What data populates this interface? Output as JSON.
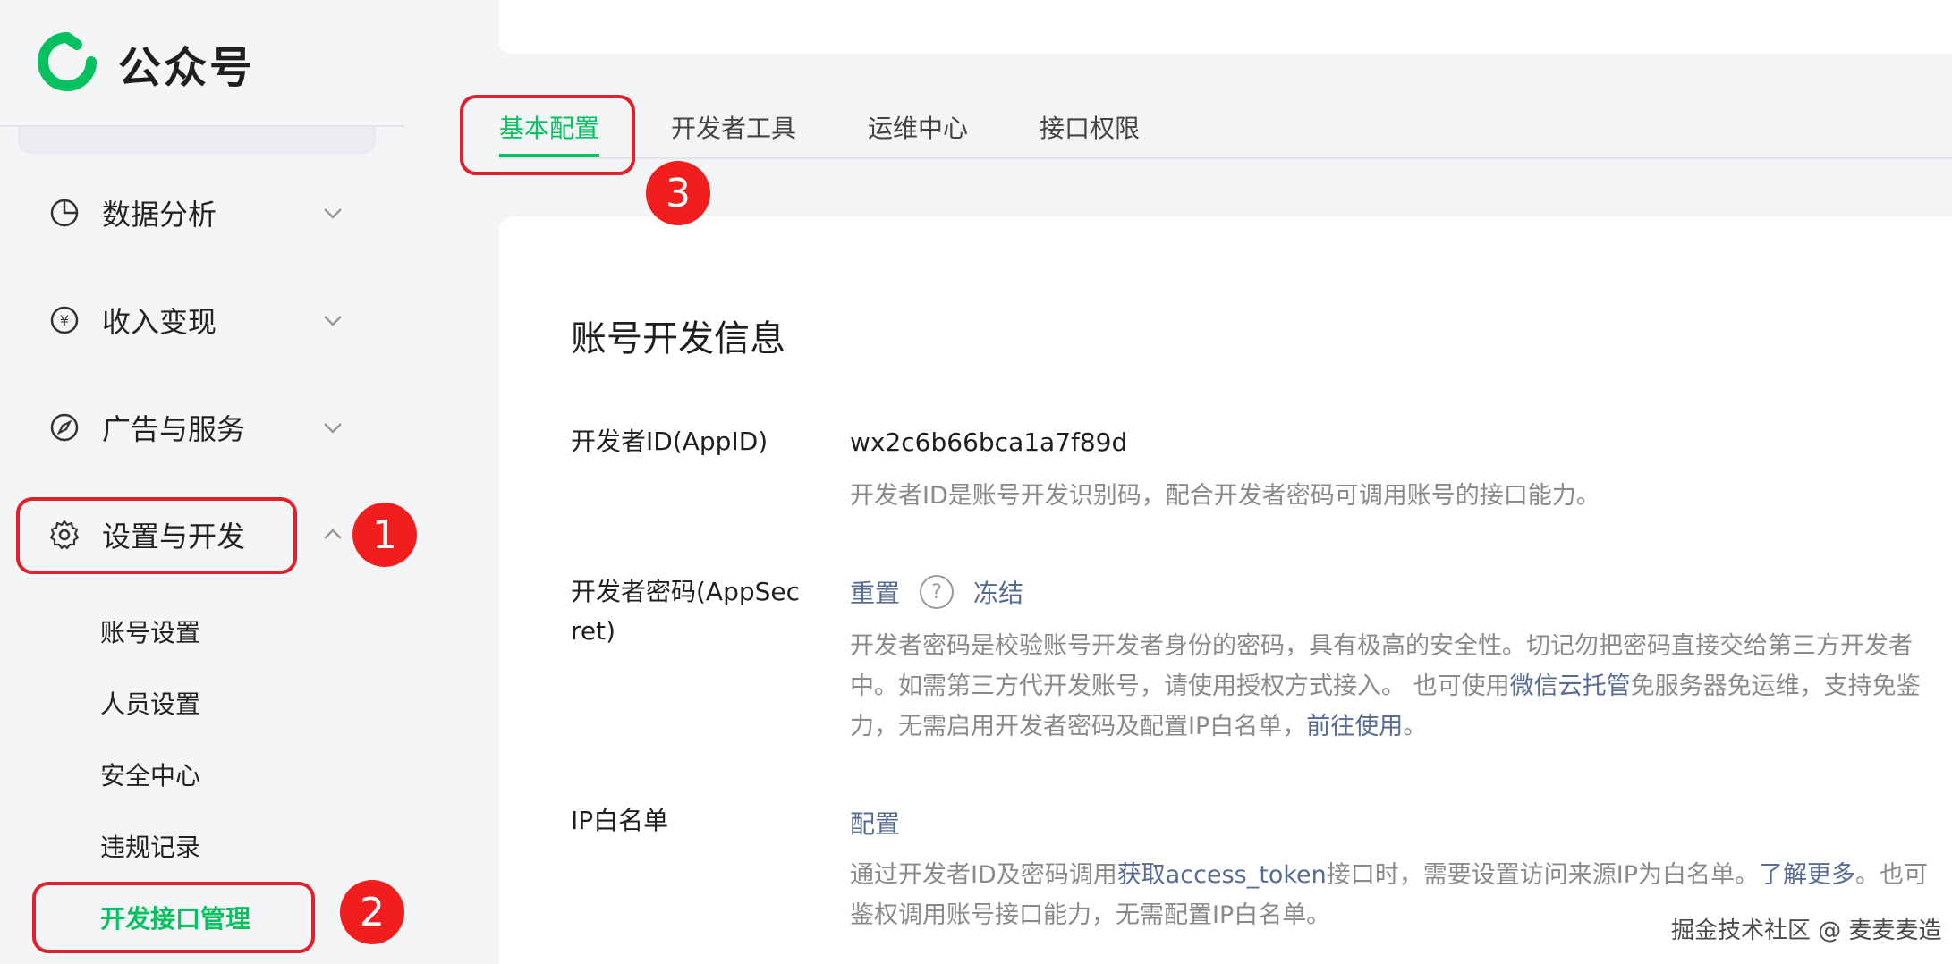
{
  "sidebar": {
    "brand_title": "公众号",
    "nav": [
      {
        "label": "数据分析",
        "icon": "pie-chart-icon"
      },
      {
        "label": "收入变现",
        "icon": "yen-coin-icon"
      },
      {
        "label": "广告与服务",
        "icon": "compass-icon"
      },
      {
        "label": "设置与开发",
        "icon": "gear-icon"
      }
    ],
    "sub_items": [
      "账号设置",
      "人员设置",
      "安全中心",
      "违规记录",
      "开发接口管理"
    ]
  },
  "tabs": [
    "基本配置",
    "开发者工具",
    "运维中心",
    "接口权限"
  ],
  "section_title": "账号开发信息",
  "fields": {
    "appid": {
      "label": "开发者ID(AppID)",
      "value": "wx2c6b66bca1a7f89d",
      "desc": "开发者ID是账号开发识别码，配合开发者密码可调用账号的接口能力。"
    },
    "appsecret": {
      "label_line1": "开发者密码(AppSec",
      "label_line2": "ret)",
      "reset": "重置",
      "help": "?",
      "freeze": "冻结",
      "desc_line1": "开发者密码是校验账号开发者身份的密码，具有极高的安全性。切记勿把密码直接交给第三方开发者",
      "desc_line2_a": "中。如需第三方代开发账号，请使用授权方式接入。 也可使用",
      "desc_line2_link": "微信云托管",
      "desc_line2_b": "免服务器免运维，支持免鉴",
      "desc_line3_a": "力，无需启用开发者密码及配置IP白名单，",
      "desc_line3_link": "前往使用",
      "desc_line3_b": "。"
    },
    "ip_whitelist": {
      "label": "IP白名单",
      "action": "配置",
      "desc_line1_a": "通过开发者ID及密码调用",
      "desc_line1_link": "获取access_token",
      "desc_line1_b": "接口时，需要设置访问来源IP为白名单。",
      "desc_line1_link2": "了解更多",
      "desc_line1_c": "。也可",
      "desc_line2": "鉴权调用账号接口能力，无需配置IP白名单。"
    }
  },
  "annotations": [
    "1",
    "2",
    "3"
  ],
  "watermark": "掘金技术社区 @ 麦麦麦造",
  "colors": {
    "brand_green": "#07c160",
    "link_blue": "#576b95",
    "annotation_red": "#e0202a"
  }
}
